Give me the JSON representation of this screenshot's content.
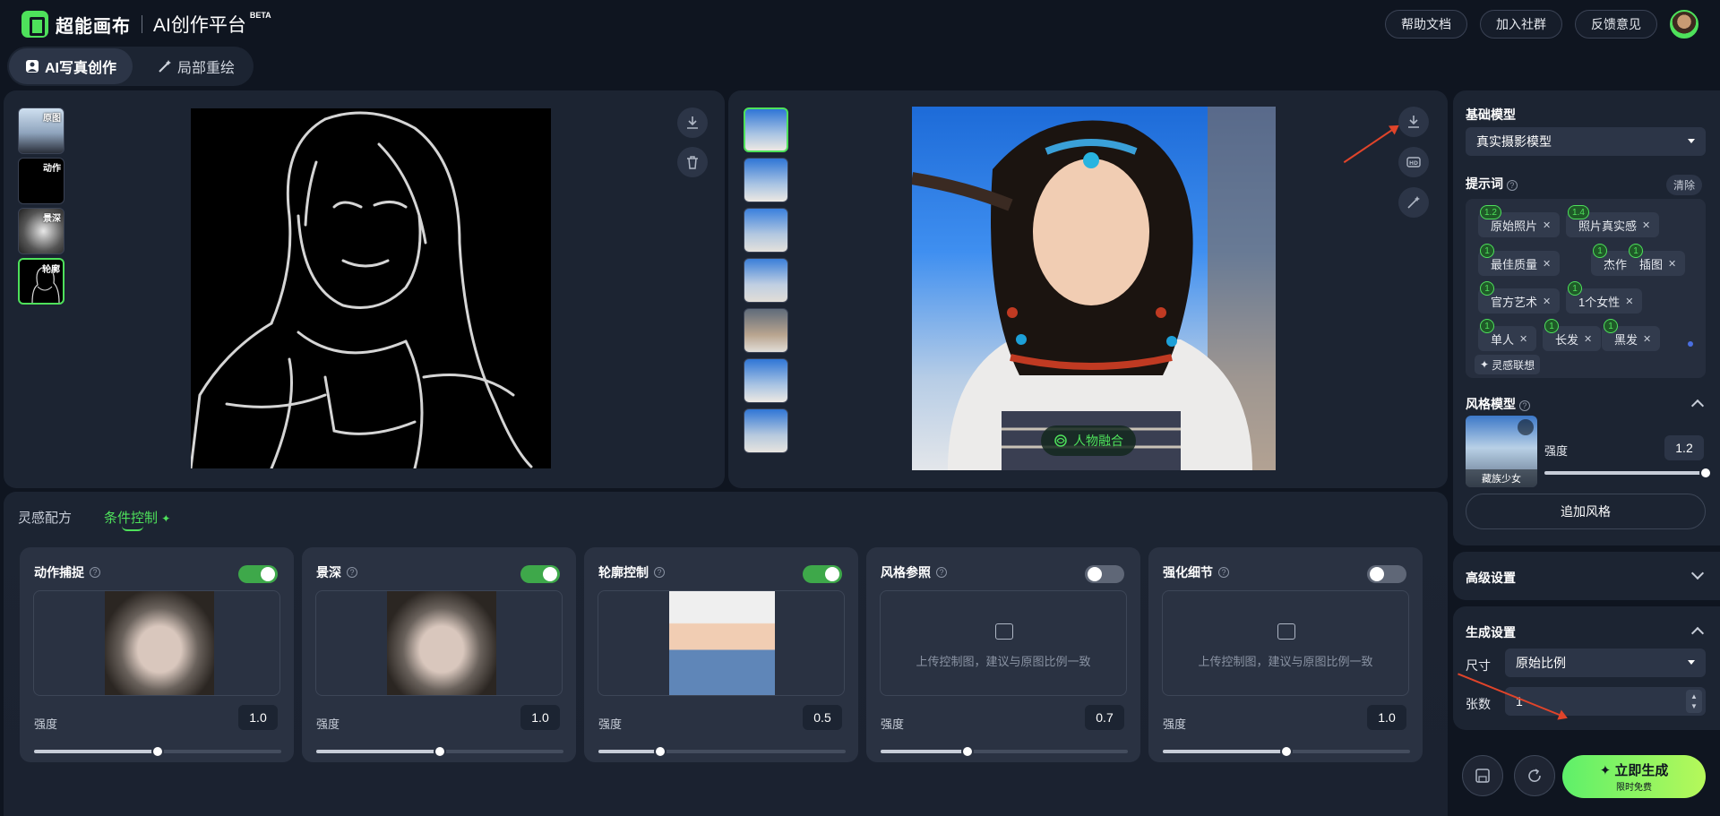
{
  "app": {
    "logo_name": "超能画布",
    "platform": "AI创作平台",
    "beta": "BETA"
  },
  "header": {
    "help": "帮助文档",
    "community": "加入社群",
    "feedback": "反馈意见"
  },
  "mode_tabs": {
    "active": "AI写真创作",
    "other": "局部重绘"
  },
  "source_thumbs": [
    "原图",
    "动作",
    "景深",
    "轮廓"
  ],
  "result": {
    "fusion": "人物融合"
  },
  "control_tabs": {
    "recipe": "灵感配方",
    "condition": "条件控制"
  },
  "cards": [
    {
      "title": "动作捕捉",
      "enabled": true,
      "strength_label": "强度",
      "strength": "1.0",
      "slider": 0.5
    },
    {
      "title": "景深",
      "enabled": true,
      "strength_label": "强度",
      "strength": "1.0",
      "slider": 0.5
    },
    {
      "title": "轮廓控制",
      "enabled": true,
      "strength_label": "强度",
      "strength": "0.5",
      "slider": 0.25
    },
    {
      "title": "风格参照",
      "enabled": false,
      "strength_label": "强度",
      "strength": "0.7",
      "slider": 0.35,
      "upload_hint": "上传控制图，建议与原图比例一致"
    },
    {
      "title": "强化细节",
      "enabled": false,
      "strength_label": "强度",
      "strength": "1.0",
      "slider": 0.5,
      "upload_hint": "上传控制图，建议与原图比例一致"
    }
  ],
  "sidebar": {
    "base_model_label": "基础模型",
    "base_model_value": "真实摄影模型",
    "prompt_label": "提示词",
    "clear": "清除",
    "tags": [
      {
        "w": "1.2",
        "t": "原始照片"
      },
      {
        "w": "1.4",
        "t": "照片真实感"
      },
      {
        "w": "1",
        "t": "最佳质量"
      },
      {
        "w": "1",
        "t": "杰作"
      },
      {
        "w": "1",
        "t": "插图"
      },
      {
        "w": "1",
        "t": "官方艺术"
      },
      {
        "w": "1",
        "t": "1个女性"
      },
      {
        "w": "1",
        "t": "单人"
      },
      {
        "w": "1",
        "t": "长发"
      },
      {
        "w": "1",
        "t": "黑发"
      }
    ],
    "inspire": "灵感联想",
    "style_label": "风格模型",
    "style_name": "藏族少女",
    "style_strength_label": "强度",
    "style_strength": "1.2",
    "add_style": "追加风格",
    "advanced": "高级设置",
    "gen_settings": "生成设置",
    "size_label": "尺寸",
    "size_value": "原始比例",
    "count_label": "张数",
    "count_value": "1",
    "generate": "立即生成",
    "generate_sub": "限时免费"
  }
}
